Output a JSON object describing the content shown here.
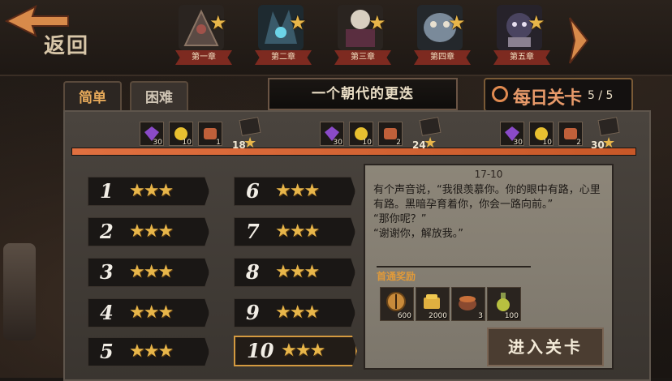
{
  "nav": {
    "back_label": "返回"
  },
  "chapters": [
    {
      "label": "第一章",
      "icon": "chapter-one-portrait",
      "star": "★"
    },
    {
      "label": "第二章",
      "icon": "chapter-two-portrait",
      "star": "★"
    },
    {
      "label": "第三章",
      "icon": "chapter-three-portrait",
      "star": "★"
    },
    {
      "label": "第四章",
      "icon": "chapter-four-portrait",
      "star": "★"
    },
    {
      "label": "第五章",
      "icon": "chapter-five-portrait",
      "star": "★"
    }
  ],
  "tabs": {
    "easy": "简单",
    "hard": "困难"
  },
  "chapter_title": "一个朝代的更迭",
  "daily": {
    "label": "每日关卡",
    "count": "5 / 5"
  },
  "progress": {
    "fraction": 1.0,
    "milestones": [
      {
        "stars": "18",
        "rewards": [
          {
            "icon": "purple-gem-icon",
            "qty": "30"
          },
          {
            "icon": "gold-coin-icon",
            "qty": "10"
          },
          {
            "icon": "scroll-icon",
            "qty": "1"
          }
        ]
      },
      {
        "stars": "24",
        "rewards": [
          {
            "icon": "purple-gem-icon",
            "qty": "30"
          },
          {
            "icon": "gold-coin-icon",
            "qty": "10"
          },
          {
            "icon": "scroll-icon",
            "qty": "2"
          }
        ]
      },
      {
        "stars": "30",
        "rewards": [
          {
            "icon": "purple-gem-icon",
            "qty": "30"
          },
          {
            "icon": "gold-coin-icon",
            "qty": "10"
          },
          {
            "icon": "scroll-icon",
            "qty": "2"
          }
        ]
      }
    ]
  },
  "levels": [
    {
      "num": "1",
      "stars": "★★★"
    },
    {
      "num": "2",
      "stars": "★★★"
    },
    {
      "num": "3",
      "stars": "★★★"
    },
    {
      "num": "4",
      "stars": "★★★"
    },
    {
      "num": "5",
      "stars": "★★★"
    },
    {
      "num": "6",
      "stars": "★★★"
    },
    {
      "num": "7",
      "stars": "★★★"
    },
    {
      "num": "8",
      "stars": "★★★"
    },
    {
      "num": "9",
      "stars": "★★★"
    },
    {
      "num": "10",
      "stars": "★★★"
    }
  ],
  "detail": {
    "title": "17-10",
    "story": "有个声音说，“我很羡慕你。你的眼中有路，心里有路。黑暗孕育着你，你会一路向前。”\n“那你呢？”\n“谢谢你，解放我。”",
    "rewards_label": "首通奖励",
    "drops": [
      {
        "icon": "compass-icon",
        "qty": "600"
      },
      {
        "icon": "gold-stack-icon",
        "qty": "2000"
      },
      {
        "icon": "cauldron-icon",
        "qty": "3"
      },
      {
        "icon": "potion-icon",
        "qty": "100"
      }
    ],
    "enter_label": "进入关卡"
  }
}
